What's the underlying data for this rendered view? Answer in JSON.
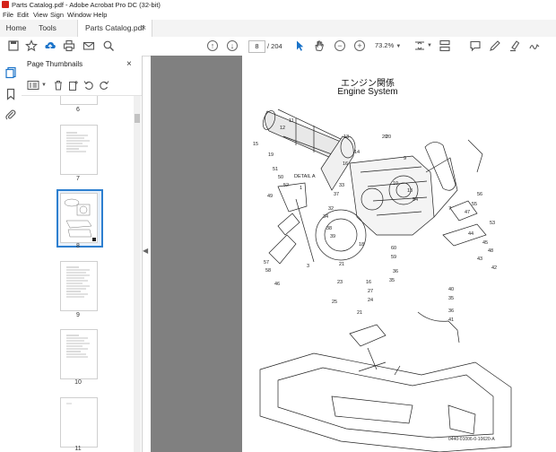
{
  "window": {
    "title": "Parts Catalog.pdf - Adobe Acrobat Pro DC (32-bit)"
  },
  "menu": [
    "File",
    "Edit",
    "View",
    "Sign",
    "Window",
    "Help"
  ],
  "tabs": [
    {
      "label": "Home"
    },
    {
      "label": "Tools"
    },
    {
      "label": "Parts Catalog.pdf",
      "close": "×"
    }
  ],
  "toolbar": {
    "current_page": "8",
    "page_count": "/ 204",
    "zoom": "73.2%"
  },
  "thumbnails": {
    "title": "Page Thumbnails",
    "close": "×",
    "pages": [
      "6",
      "7",
      "8",
      "9",
      "10",
      "11"
    ],
    "selected": "8"
  },
  "collapse_glyph": "◀",
  "document": {
    "heading_jp": "エンジン関係",
    "heading_en": "Engine System",
    "detail_label": "DETAIL A",
    "footer_code": "0440-01006-0-10620-A",
    "callouts": [
      "12",
      "11",
      "13",
      "14",
      "16",
      "15",
      "19",
      "20",
      "51",
      "50",
      "52",
      "49",
      "1",
      "57",
      "58",
      "46",
      "56",
      "55",
      "47",
      "53",
      "44",
      "45",
      "48",
      "43",
      "42",
      "33",
      "37",
      "32",
      "34",
      "38",
      "39",
      "20",
      "18",
      "10",
      "13",
      "7",
      "54",
      "9",
      "60",
      "59",
      "36",
      "35",
      "40",
      "35",
      "36",
      "41",
      "21",
      "23",
      "3",
      "16",
      "27",
      "24",
      "25",
      "21",
      "22",
      "20",
      "66",
      "65"
    ]
  },
  "colors": {
    "accent": "#1a73c9",
    "doc_bg": "#808080",
    "selected_thumb": "#2d7fd0",
    "acrobat_red": "#d4231a"
  }
}
